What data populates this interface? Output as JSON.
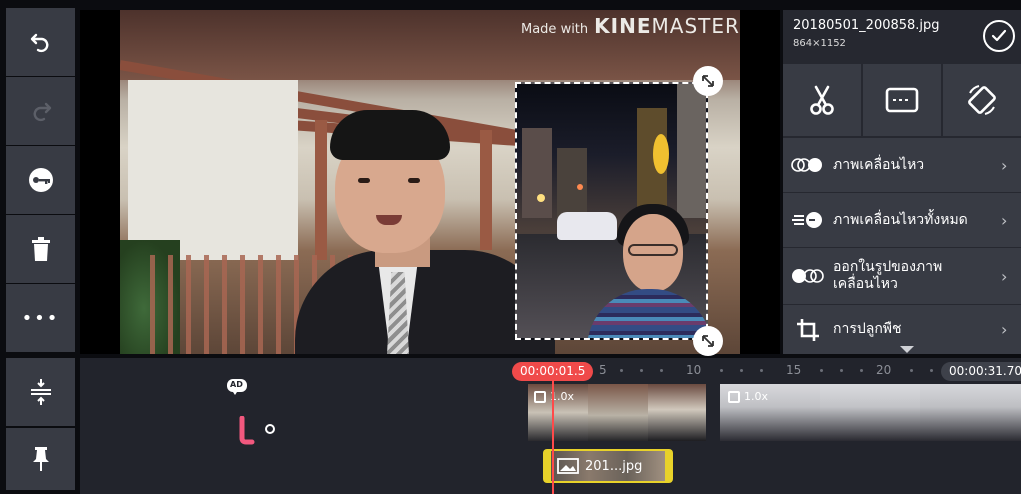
{
  "left_toolbar": {
    "items": [
      "undo",
      "redo",
      "keyframe",
      "delete",
      "more",
      "timeline-expand",
      "pin"
    ],
    "more_glyph": "•••"
  },
  "preview": {
    "watermark_small": "Made with",
    "watermark_kine": "KINE",
    "watermark_master": "MASTER"
  },
  "right_panel": {
    "title": "20180501_200858.jpg",
    "subtitle": "864×1152",
    "tools": [
      "cut",
      "caption",
      "rotate"
    ],
    "menu": [
      {
        "label": "ภาพเคลื่อนไหว",
        "icon": "in-animation-icon"
      },
      {
        "label": "ภาพเคลื่อนไหวทั้งหมด",
        "icon": "overall-animation-icon"
      },
      {
        "label": "ออกในรูปของภาพ\nเคลื่อนไหว",
        "label_line1": "ออกในรูปของภาพ",
        "label_line2": "เคลื่อนไหว",
        "icon": "out-animation-icon"
      },
      {
        "label": "การปลูกพืช",
        "icon": "crop-icon"
      }
    ],
    "chevron": "›"
  },
  "timeline": {
    "playhead_time": "00:00:01.5",
    "total_time": "00:00:31.70",
    "ruler_labels": [
      "5",
      "10",
      "15",
      "20"
    ],
    "clips": [
      {
        "speed": "1.0x"
      },
      {
        "speed": "1.0x"
      }
    ],
    "layer_label": "201...jpg",
    "audio_badge": "AD"
  },
  "colors": {
    "accent_red": "#f04a4a",
    "layer_yellow": "#e8d22a",
    "panel_bg": "#383b44",
    "audio_pink": "#f2587e"
  }
}
